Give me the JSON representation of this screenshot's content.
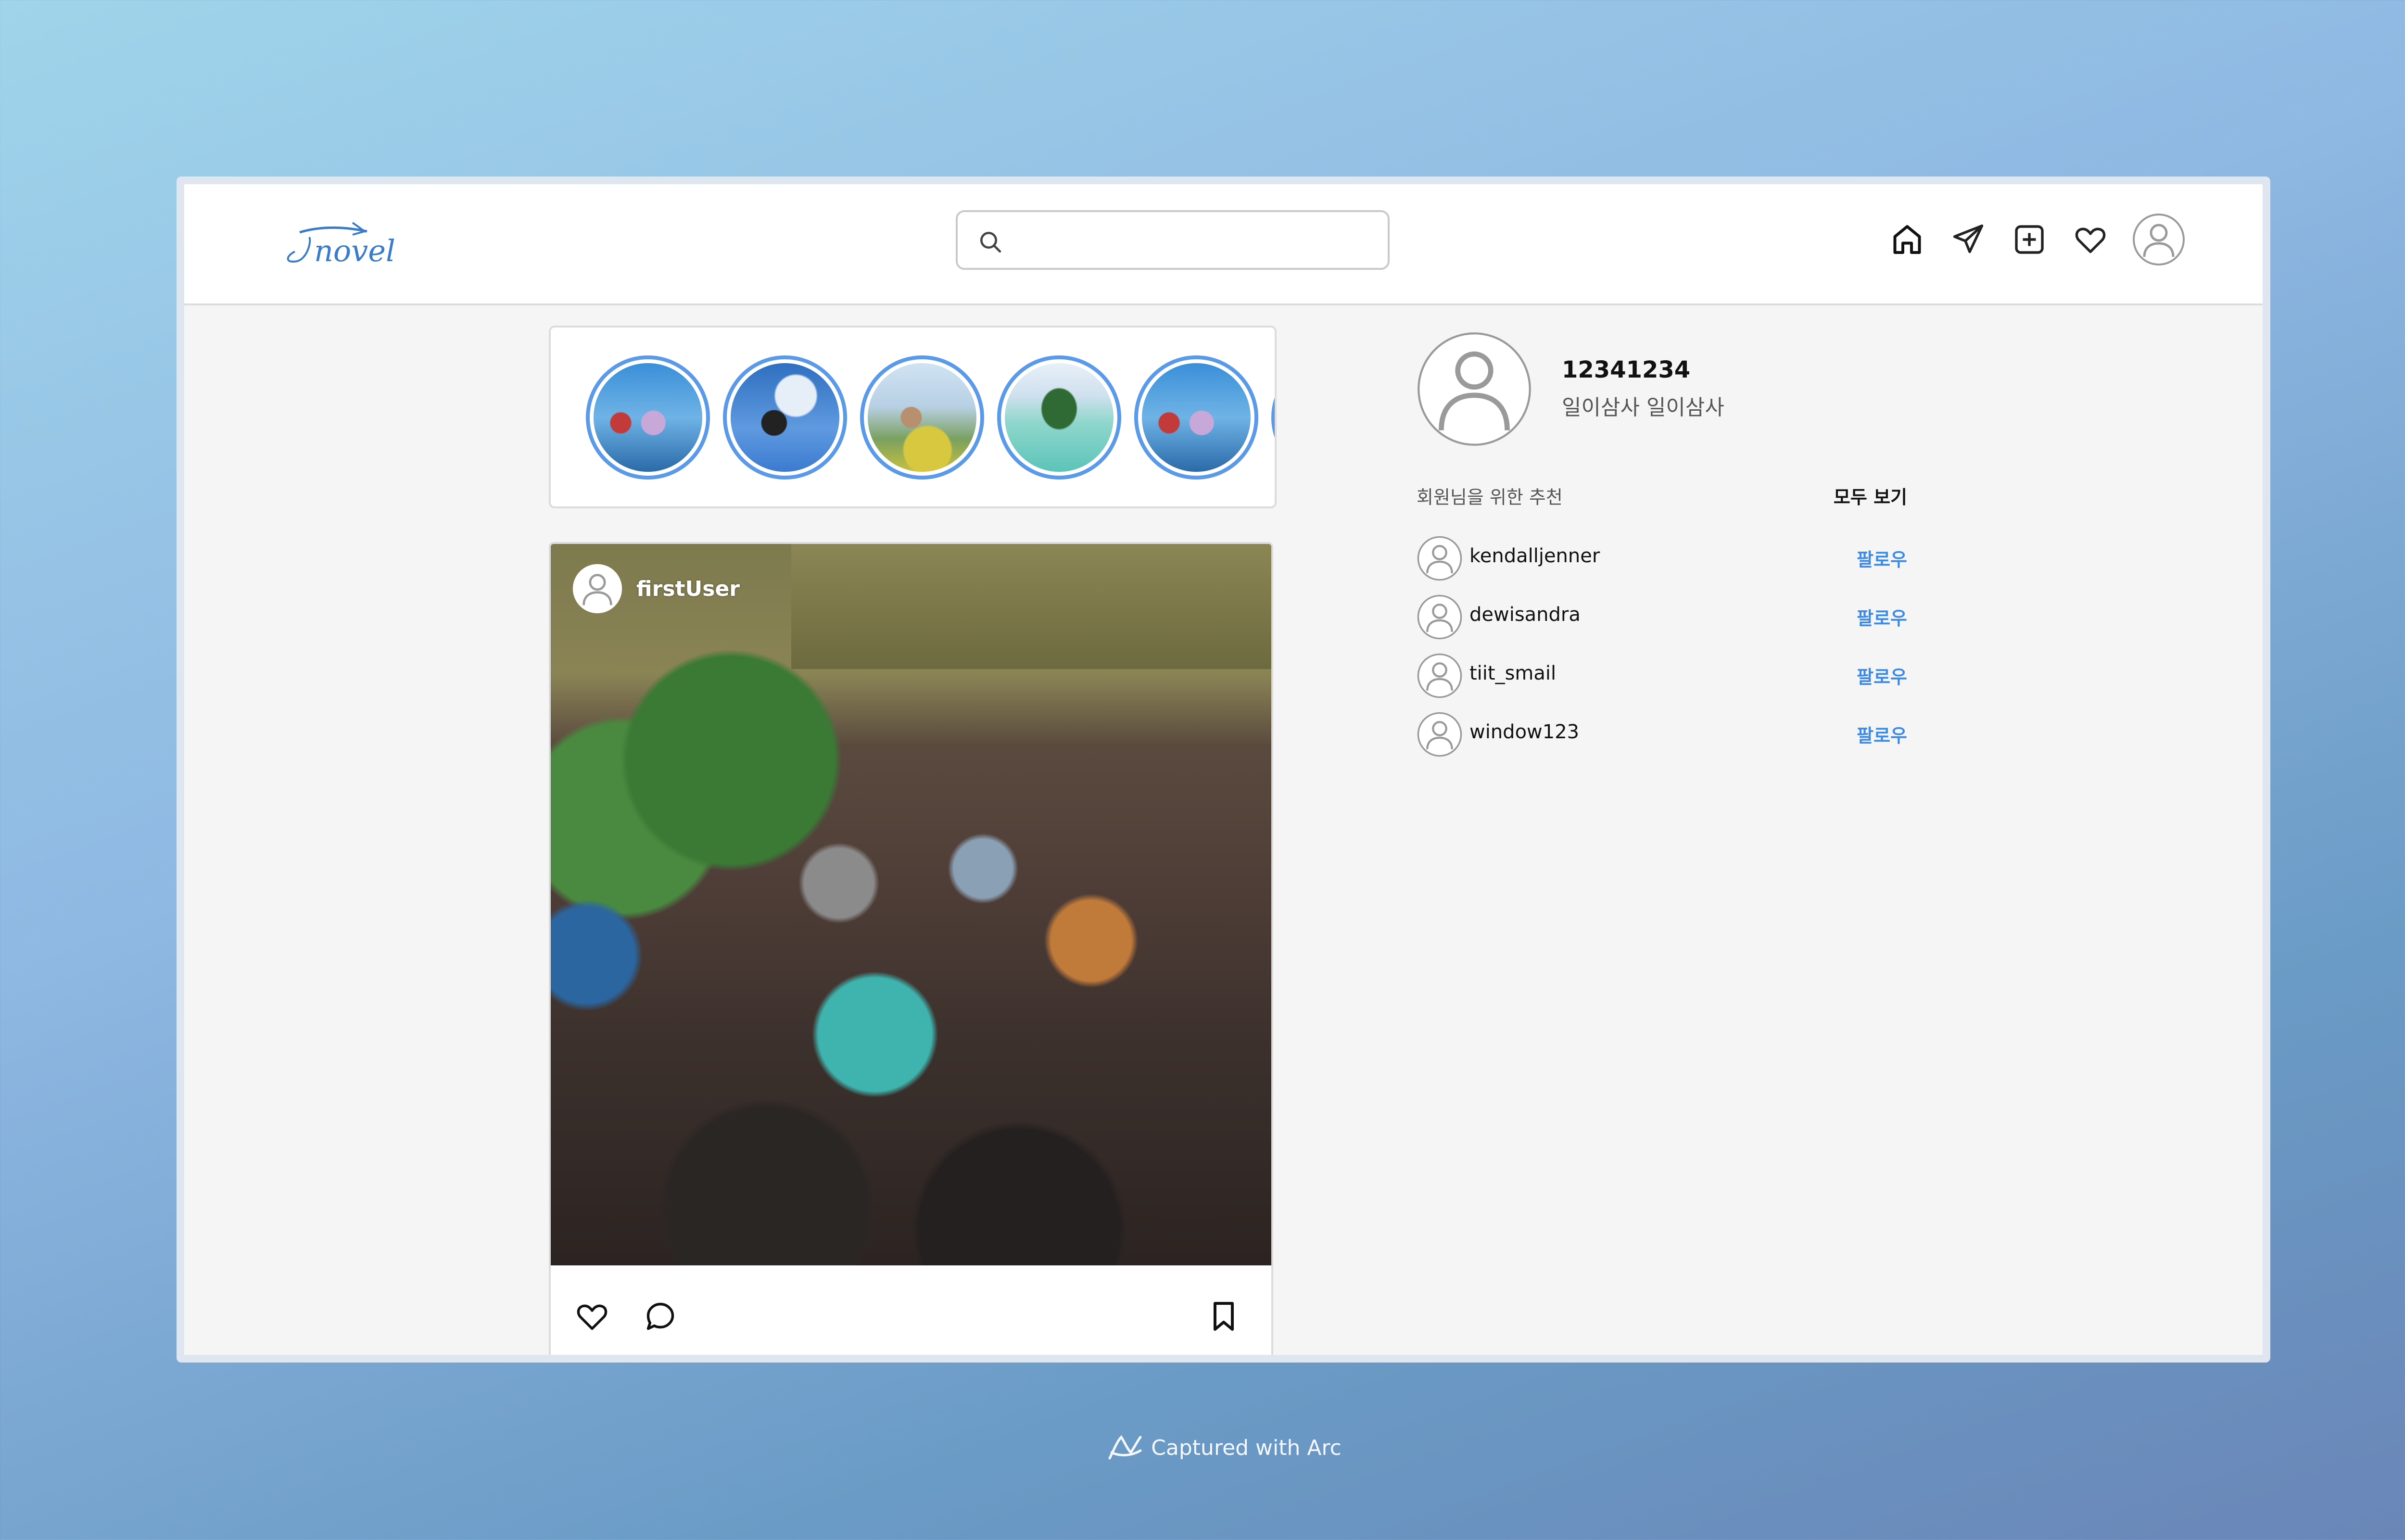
{
  "app": {
    "logo_text": "Tnovel"
  },
  "search": {
    "placeholder": ""
  },
  "nav": {
    "icons": [
      "home-icon",
      "send-icon",
      "add-post-icon",
      "heart-icon",
      "profile-icon"
    ]
  },
  "stories": {
    "count": 6,
    "accent_color": "#5a9ae8"
  },
  "post": {
    "username": "firstUser"
  },
  "profile": {
    "user_id": "12341234",
    "user_name": "일이삼사 일이삼사"
  },
  "recommend": {
    "title": "회원님을 위한 추천",
    "see_all": "모두 보기",
    "items": [
      {
        "username": "kendalljenner",
        "action": "팔로우"
      },
      {
        "username": "dewisandra",
        "action": "팔로우"
      },
      {
        "username": "tiit_smail",
        "action": "팔로우"
      },
      {
        "username": "window123",
        "action": "팔로우"
      }
    ]
  },
  "footer": {
    "caption": "Captured with Arc"
  },
  "colors": {
    "accent": "#3b8ae6",
    "logo": "#3a7cc9"
  }
}
